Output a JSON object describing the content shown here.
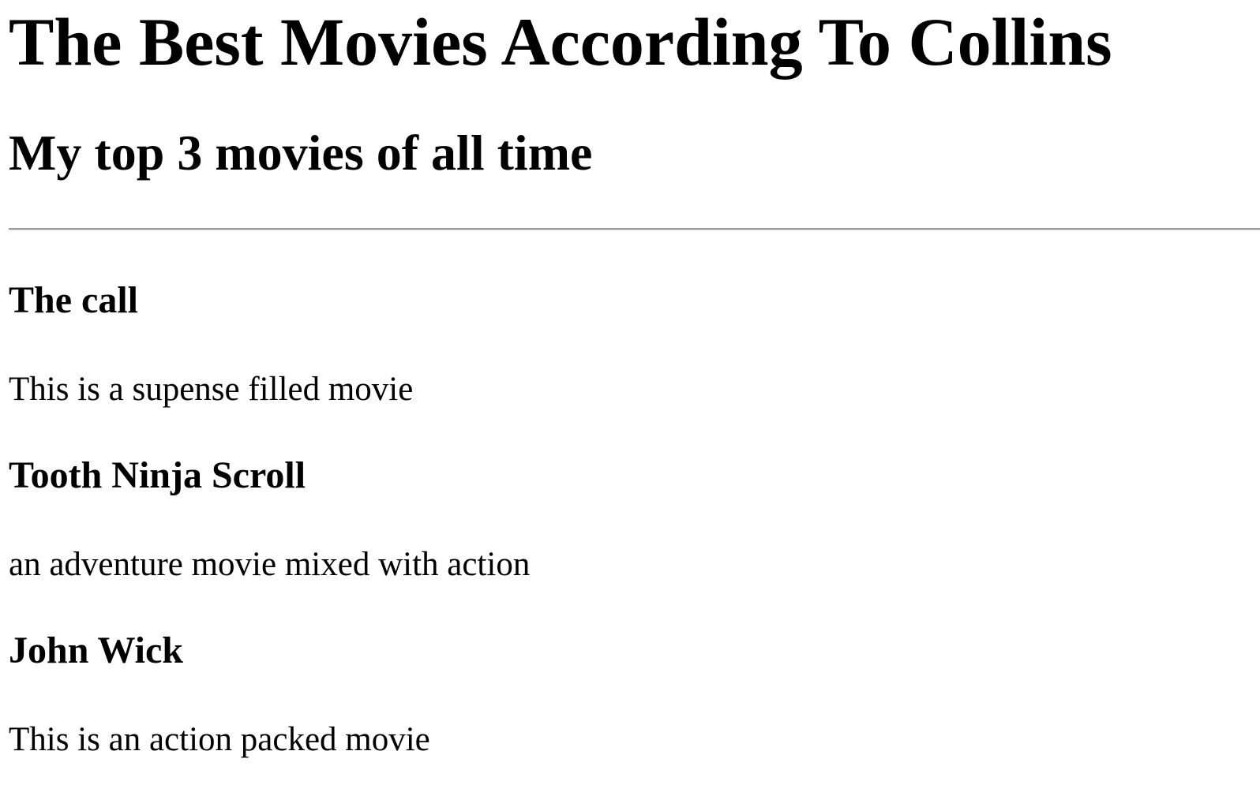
{
  "page": {
    "heading": "The Best Movies According To Collins",
    "subheading": "My top 3 movies of all time"
  },
  "movies": [
    {
      "title": "The call",
      "description": "This is a supense filled movie"
    },
    {
      "title": "Tooth Ninja Scroll",
      "description": "an adventure movie mixed with action"
    },
    {
      "title": "John Wick",
      "description": "This is an action packed movie"
    }
  ]
}
